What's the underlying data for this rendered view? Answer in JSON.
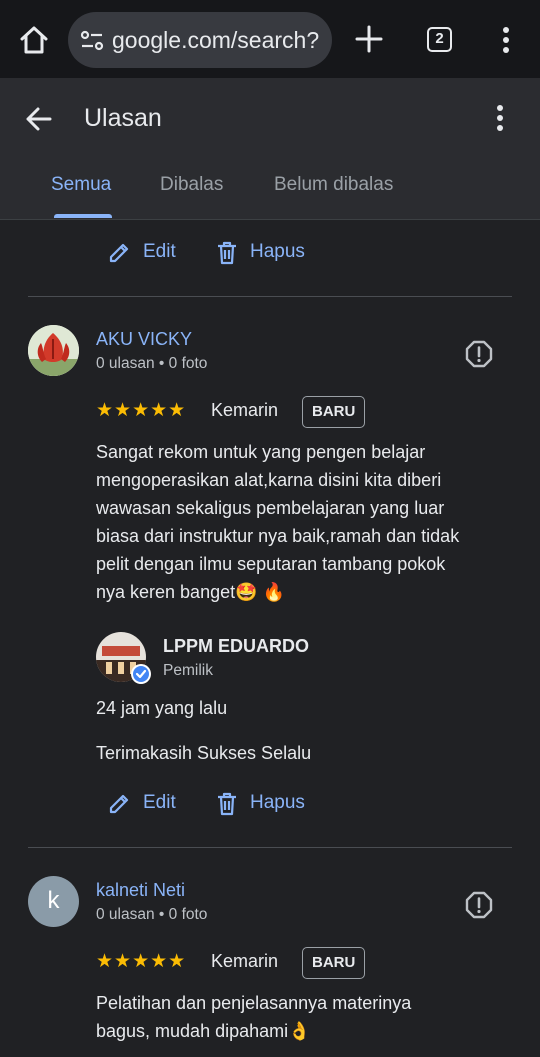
{
  "browser": {
    "url": "google.com/search?",
    "tab_count": "2"
  },
  "header": {
    "title": "Ulasan",
    "tabs": [
      {
        "label": "Semua",
        "active": true
      },
      {
        "label": "Dibalas",
        "active": false
      },
      {
        "label": "Belum dibalas",
        "active": false
      }
    ]
  },
  "top_actions": {
    "edit_label": "Edit",
    "delete_label": "Hapus"
  },
  "reviews": [
    {
      "name": "AKU VICKY",
      "meta": "0 ulasan • 0 foto",
      "stars": "★★★★★",
      "rating": 5,
      "date": "Kemarin",
      "badge": "BARU",
      "lines": [
        "Sangat rekom untuk yang pengen belajar",
        "mengoperasikan alat,karna disini kita diberi",
        "wawasan sekaligus pembelajaran yang luar",
        "biasa dari instruktur nya baik,ramah dan tidak",
        "pelit dengan ilmu seputaran tambang pokok",
        "nya keren banget🤩 🔥"
      ],
      "reply": {
        "owner_name": "LPPM EDUARDO",
        "owner_role": "Pemilik",
        "time": "24 jam yang lalu",
        "text": "Terimakasih Sukses Selalu",
        "edit_label": "Edit",
        "delete_label": "Hapus"
      }
    },
    {
      "name": "kalneti Neti",
      "avatar_letter": "k",
      "meta": "0 ulasan • 0 foto",
      "stars": "★★★★★",
      "rating": 5,
      "date": "Kemarin",
      "badge": "BARU",
      "lines": [
        "Pelatihan dan penjelasannya materinya",
        "bagus, mudah dipahami👌"
      ]
    }
  ],
  "colors": {
    "accent": "#8ab4f8",
    "star": "#fbbc04",
    "background": "#202124",
    "header": "#2b2c30"
  }
}
